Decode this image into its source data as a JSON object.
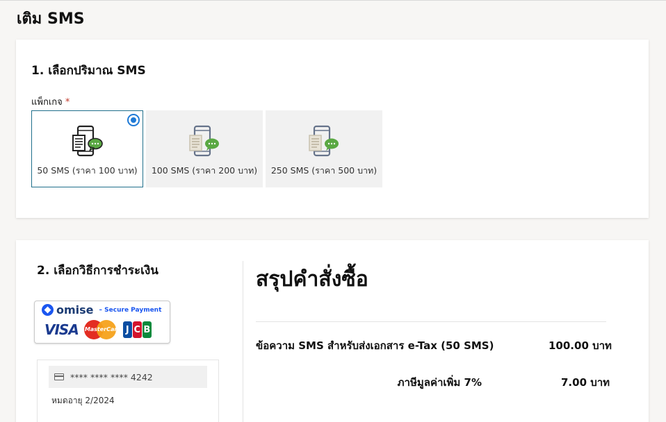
{
  "page": {
    "title": "เติม SMS"
  },
  "section1": {
    "title": "1. เลือกปริมาณ SMS",
    "package_label": "แพ็กเกจ",
    "required_mark": "*",
    "packages": [
      {
        "label": "50 SMS (ราคา 100 บาท)",
        "selected": true,
        "icon": "phone-document-chat-icon"
      },
      {
        "label": "100 SMS (ราคา 200 บาท)",
        "selected": false,
        "icon": "phone-document-chat-icon"
      },
      {
        "label": "250 SMS (ราคา 500 บาท)",
        "selected": false,
        "icon": "phone-document-chat-icon"
      }
    ]
  },
  "section2": {
    "title": "2. เลือกวิธีการชำระเงิน",
    "omise": {
      "brand": "omise",
      "tagline": "Secure Payment",
      "logos": {
        "visa": "VISA",
        "mastercard": "MasterCard",
        "jcb": "JCB"
      }
    },
    "saved_card": {
      "number": "**** **** **** 4242",
      "expiry": "หมดอายุ 2/2024"
    }
  },
  "summary": {
    "title": "สรุปคำสั่งซื้อ",
    "items": [
      {
        "label": "ข้อความ SMS สำหรับส่งเอกสาร e-Tax (50 SMS)",
        "value": "100.00 บาท"
      },
      {
        "label": "ภาษีมูลค่าเพิ่ม 7%",
        "value": "7.00 บาท"
      }
    ]
  },
  "colors": {
    "accent": "#1f7ad6",
    "selected_border": "#1f6f8b",
    "page_bg": "#f7f6f4",
    "chat_bubble": "#5aa843"
  }
}
